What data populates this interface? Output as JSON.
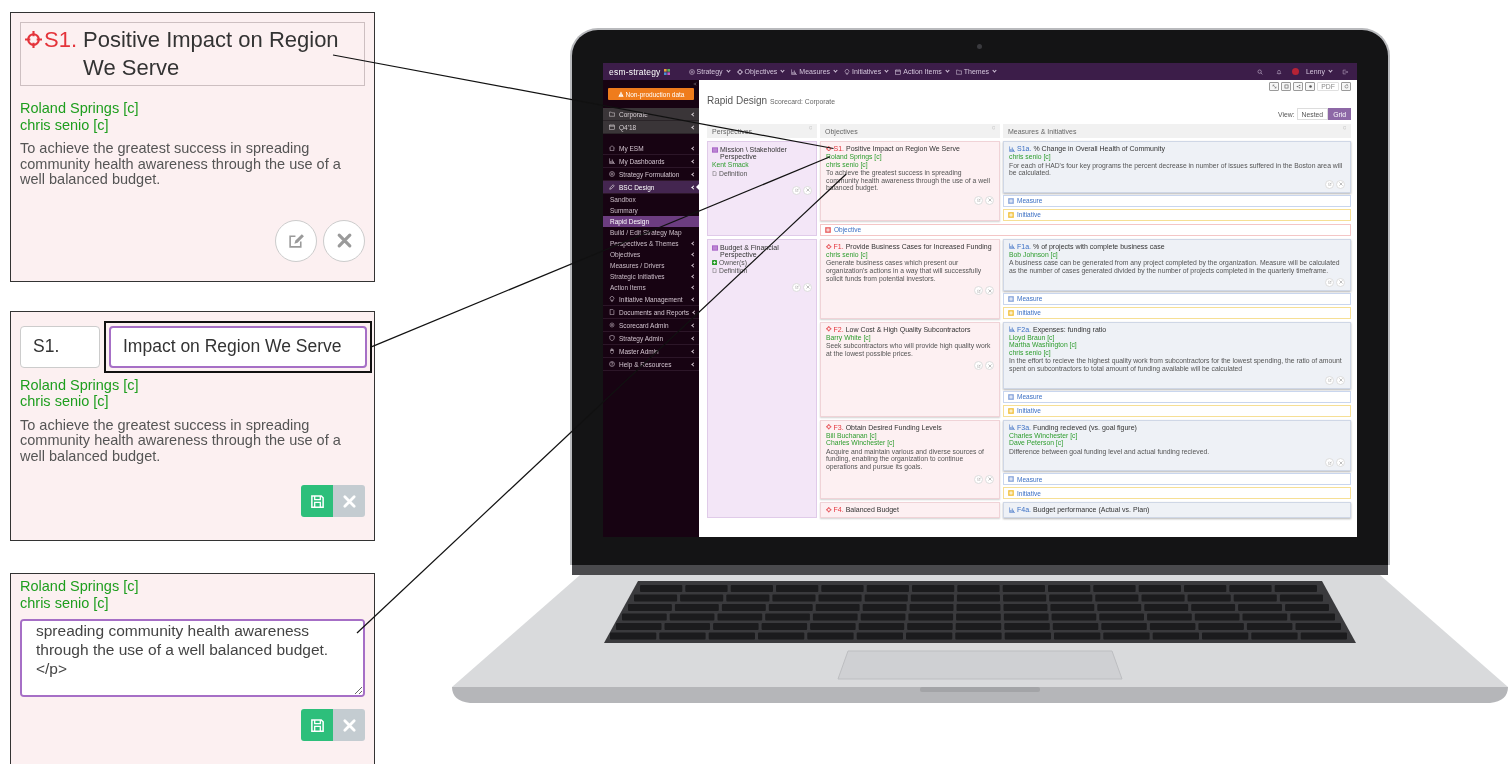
{
  "callouts": [
    {
      "kind": "view",
      "code": "S1.",
      "title": "Positive Impact on Region We Serve",
      "owners": [
        "Roland Springs [c]",
        "chris senio [c]"
      ],
      "description": "To achieve the greatest success in spreading community health awareness through the use of a well balanced budget."
    },
    {
      "kind": "edit_title",
      "code": "S1.",
      "title": "Impact on Region We Serve",
      "owners": [
        "Roland Springs [c]",
        "chris senio [c]"
      ],
      "description": "To achieve the greatest success in spreading community health awareness through the use of a well balanced budget."
    },
    {
      "kind": "edit_description",
      "owners": [
        "Roland Springs [c]",
        "chris senio [c]"
      ],
      "text": "spreading community health awareness\nthrough the use of a well balanced budget.\n</p>\n"
    }
  ],
  "app": {
    "logo": "esm-strategy",
    "menus": [
      "Strategy",
      "Objectives",
      "Measures",
      "Initiatives",
      "Action Items",
      "Themes"
    ],
    "user": "Lenny",
    "sidebar": {
      "notice": "Non-production data",
      "context": [
        "Corporate",
        "Q4'18"
      ],
      "items": [
        {
          "label": "My ESM",
          "expanded": false
        },
        {
          "label": "My Dashboards",
          "expanded": false
        },
        {
          "label": "Strategy Formulation",
          "expanded": false
        },
        {
          "label": "BSC Design",
          "expanded": true,
          "children": [
            {
              "label": "Sandbox",
              "selected": false,
              "expandable": false
            },
            {
              "label": "Summary",
              "selected": false,
              "expandable": false
            },
            {
              "label": "Rapid Design",
              "selected": true,
              "expandable": false
            },
            {
              "label": "Build / Edit Strategy Map",
              "selected": false,
              "expandable": false
            },
            {
              "label": "Perspectives & Themes",
              "selected": false,
              "expandable": true
            },
            {
              "label": "Objectives",
              "selected": false,
              "expandable": true
            },
            {
              "label": "Measures / Drivers",
              "selected": false,
              "expandable": true
            },
            {
              "label": "Strategic Initiatives",
              "selected": false,
              "expandable": true
            },
            {
              "label": "Action Items",
              "selected": false,
              "expandable": true
            }
          ]
        },
        {
          "label": "Initiative Management",
          "expanded": false
        },
        {
          "label": "Documents and Reports",
          "expanded": false
        },
        {
          "label": "Scorecard Admin",
          "expanded": false
        },
        {
          "label": "Strategy Admin",
          "expanded": false
        },
        {
          "label": "Master Admin",
          "expanded": false
        },
        {
          "label": "Help & Resources",
          "expanded": false
        }
      ]
    },
    "toolbar": {
      "pdf_label": "PDF",
      "pdf_disabled": true
    },
    "page_title": "Rapid Design",
    "scorecard": "Scorecard: Corporate",
    "view": {
      "label": "View:",
      "options": [
        {
          "label": "Nested",
          "selected": false
        },
        {
          "label": "Grid",
          "selected": true
        }
      ]
    },
    "columns": [
      "Perspectives",
      "Objectives",
      "Measures & Initiatives"
    ],
    "perspectives": [
      {
        "title": "Mission \\ Stakeholder Perspective",
        "owners": [
          "Kent Smack"
        ],
        "definition_label": "Definition",
        "add_objective": "Objective",
        "objectives": [
          {
            "code": "S1.",
            "title": "Positive Impact on Region We Serve",
            "owners": [
              "Roland Springs [c]",
              "chris senio [c]"
            ],
            "description": "To achieve the greatest success in spreading community health awareness through the use of a well balanced budget.",
            "measures": [
              {
                "code": "S1a.",
                "title": "% Change in Overall Health of Community",
                "owners": [
                  "chris senio [c]"
                ],
                "description": "For each of HAD's four key programs the percent decrease in number of issues suffered in the Boston area will be calculated."
              }
            ],
            "add_measure": "Measure",
            "add_initiative": "Initiative"
          }
        ]
      },
      {
        "title": "Budget & Financial Perspective",
        "add_owner_label": "Owner(s)",
        "definition_label": "Definition",
        "objectives": [
          {
            "code": "F1.",
            "title": "Provide Business Cases for Increased Funding",
            "owners": [
              "chris senio [c]"
            ],
            "description": "Generate business cases which present our organization's actions in a way that will successfully solicit funds from potential investors.",
            "measures": [
              {
                "code": "F1a.",
                "title": "% of projects with complete business case",
                "owners": [
                  "Bob Johnson [c]"
                ],
                "description": "A business case can be generated from any project completed by the organization. Measure will be calculated as the number of cases generated divided by the number of projects completed in the quarterly timeframe."
              }
            ],
            "add_measure": "Measure",
            "add_initiative": "Initiative"
          },
          {
            "code": "F2.",
            "title": "Low Cost & High Quality Subcontractors",
            "owners": [
              "Barry White [c]"
            ],
            "description": "Seek subcontractors who will provide high quality work at the lowest possible prices.",
            "measures": [
              {
                "code": "F2a.",
                "title": "Expenses: funding ratio",
                "owners": [
                  "Lloyd Braun [c]",
                  "Martha Washington [c]",
                  "chris senio [c]"
                ],
                "description": "In the effort to recieve the highest quality work from subcontractors for the lowest spending, the ratio of amount spent on subcontractors to total amount of funding available will be calculated"
              }
            ],
            "add_measure": "Measure",
            "add_initiative": "Initiative"
          },
          {
            "code": "F3.",
            "title": "Obtain Desired Funding Levels",
            "owners": [
              "Bill Buchanan [c]",
              "Charles Winchester [c]"
            ],
            "description": "Acquire and maintain various and diverse sources of funding, enabling the organization to continue operations and pursue its goals.",
            "measures": [
              {
                "code": "F3a.",
                "title": "Funding recieved (vs. goal figure)",
                "owners": [
                  "Charles Winchester [c]",
                  "Dave Peterson [c]"
                ],
                "description": "Difference between goal funding level and actual funding recieved."
              }
            ],
            "add_measure": "Measure",
            "add_initiative": "Initiative"
          },
          {
            "code": "F4.",
            "title": "Balanced Budget",
            "measures": [
              {
                "code": "F4a.",
                "title": "Budget performance (Actual vs. Plan)"
              }
            ]
          }
        ]
      }
    ]
  }
}
